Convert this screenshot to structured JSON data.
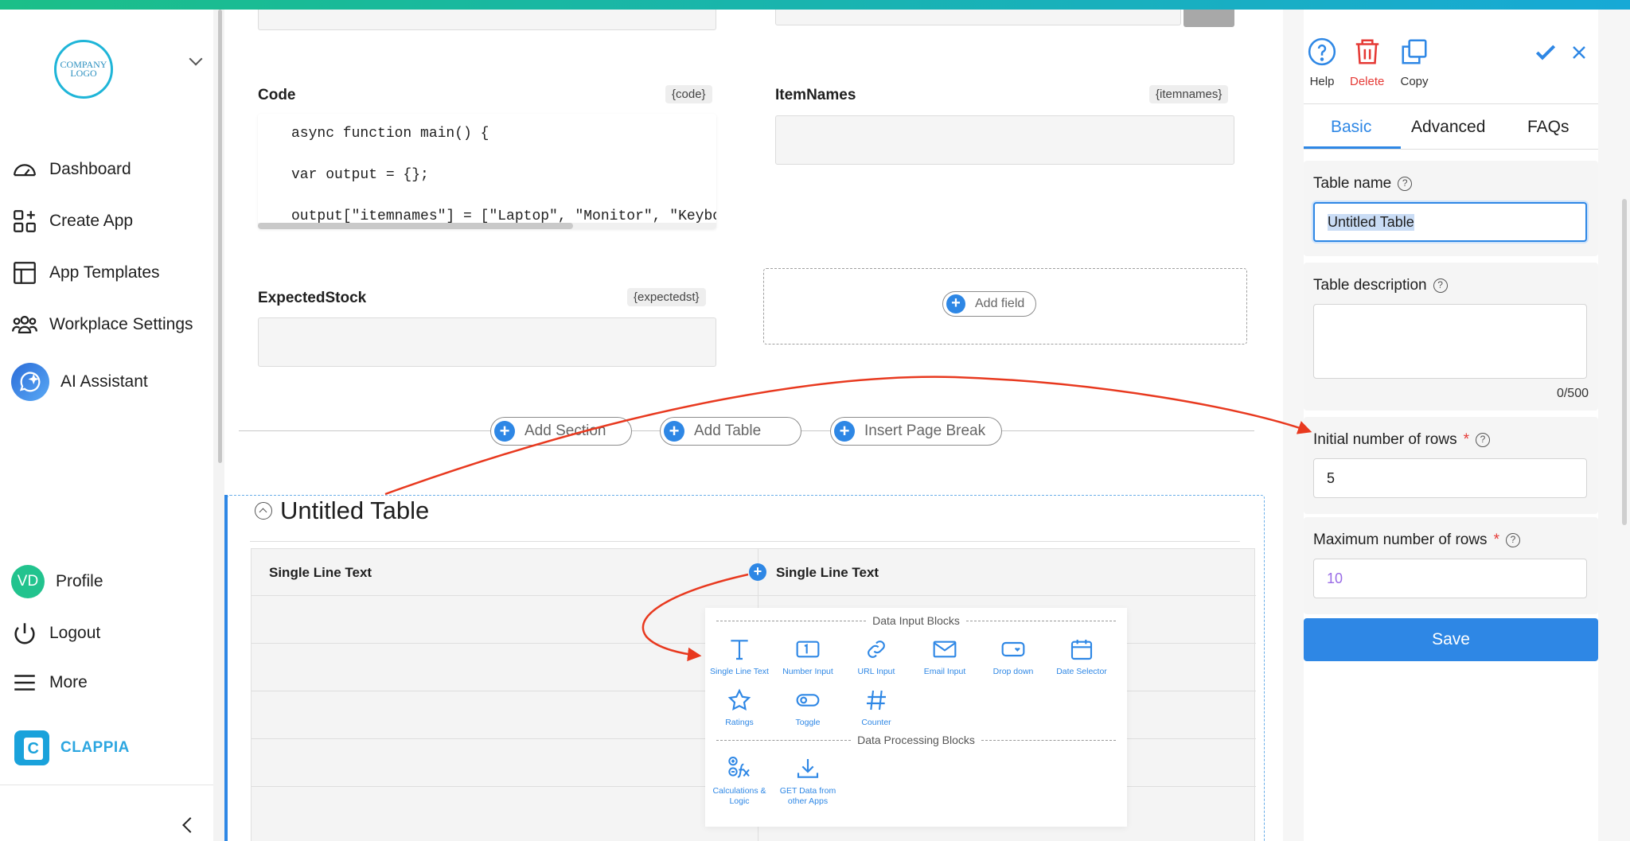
{
  "sidebar": {
    "logo_text": "COMPANY LOGO",
    "nav": [
      {
        "label": "Dashboard",
        "icon": "gauge-icon"
      },
      {
        "label": "Create App",
        "icon": "create-app-icon"
      },
      {
        "label": "App Templates",
        "icon": "templates-icon"
      },
      {
        "label": "Workplace Settings",
        "icon": "users-icon"
      },
      {
        "label": "AI Assistant",
        "icon": "ai-assistant-icon"
      }
    ],
    "bottom": [
      {
        "label": "Profile",
        "avatar": "VD"
      },
      {
        "label": "Logout",
        "icon": "power-icon"
      },
      {
        "label": "More",
        "icon": "menu-icon"
      }
    ],
    "brand": "CLAPPIA"
  },
  "canvas": {
    "fields": {
      "code": {
        "label": "Code",
        "tag": "{code}"
      },
      "itemnames": {
        "label": "ItemNames",
        "tag": "{itemnames}"
      },
      "expectedstock": {
        "label": "ExpectedStock",
        "tag": "{expectedst}"
      }
    },
    "code_lines": [
      "async function main() {",
      "var output = {};",
      "output[\"itemnames\"] = [\"Laptop\", \"Monitor\", \"Keyboa"
    ],
    "add_field_label": "Add field",
    "actions": {
      "add_section": "Add Section",
      "add_table": "Add Table",
      "insert_page_break": "Insert Page Break"
    },
    "table": {
      "title": "Untitled Table",
      "columns": [
        "Single Line Text",
        "Single Line Text"
      ]
    },
    "block_menu": {
      "input_heading": "Data Input Blocks",
      "input_blocks": [
        "Single Line Text",
        "Number Input",
        "URL Input",
        "Email Input",
        "Drop down",
        "Date Selector",
        "Ratings",
        "Toggle",
        "Counter"
      ],
      "processing_heading": "Data Processing Blocks",
      "processing_blocks": [
        "Calculations & Logic",
        "GET Data from other Apps"
      ]
    }
  },
  "panel": {
    "tools": {
      "help": "Help",
      "delete": "Delete",
      "copy": "Copy"
    },
    "tabs": [
      "Basic",
      "Advanced",
      "FAQs"
    ],
    "active_tab": "Basic",
    "table_name": {
      "label": "Table name",
      "value": "Untitled Table"
    },
    "table_description": {
      "label": "Table description",
      "counter": "0/500"
    },
    "initial_rows": {
      "label": "Initial number of rows",
      "required": "*",
      "value": "5"
    },
    "max_rows": {
      "label": "Maximum number of rows",
      "required": "*",
      "placeholder": "10"
    },
    "save_label": "Save"
  },
  "colors": {
    "accent": "#2e87e5",
    "delete": "#e53935",
    "annotation_arrow": "#e8391f",
    "brand": "#1aa2db"
  }
}
